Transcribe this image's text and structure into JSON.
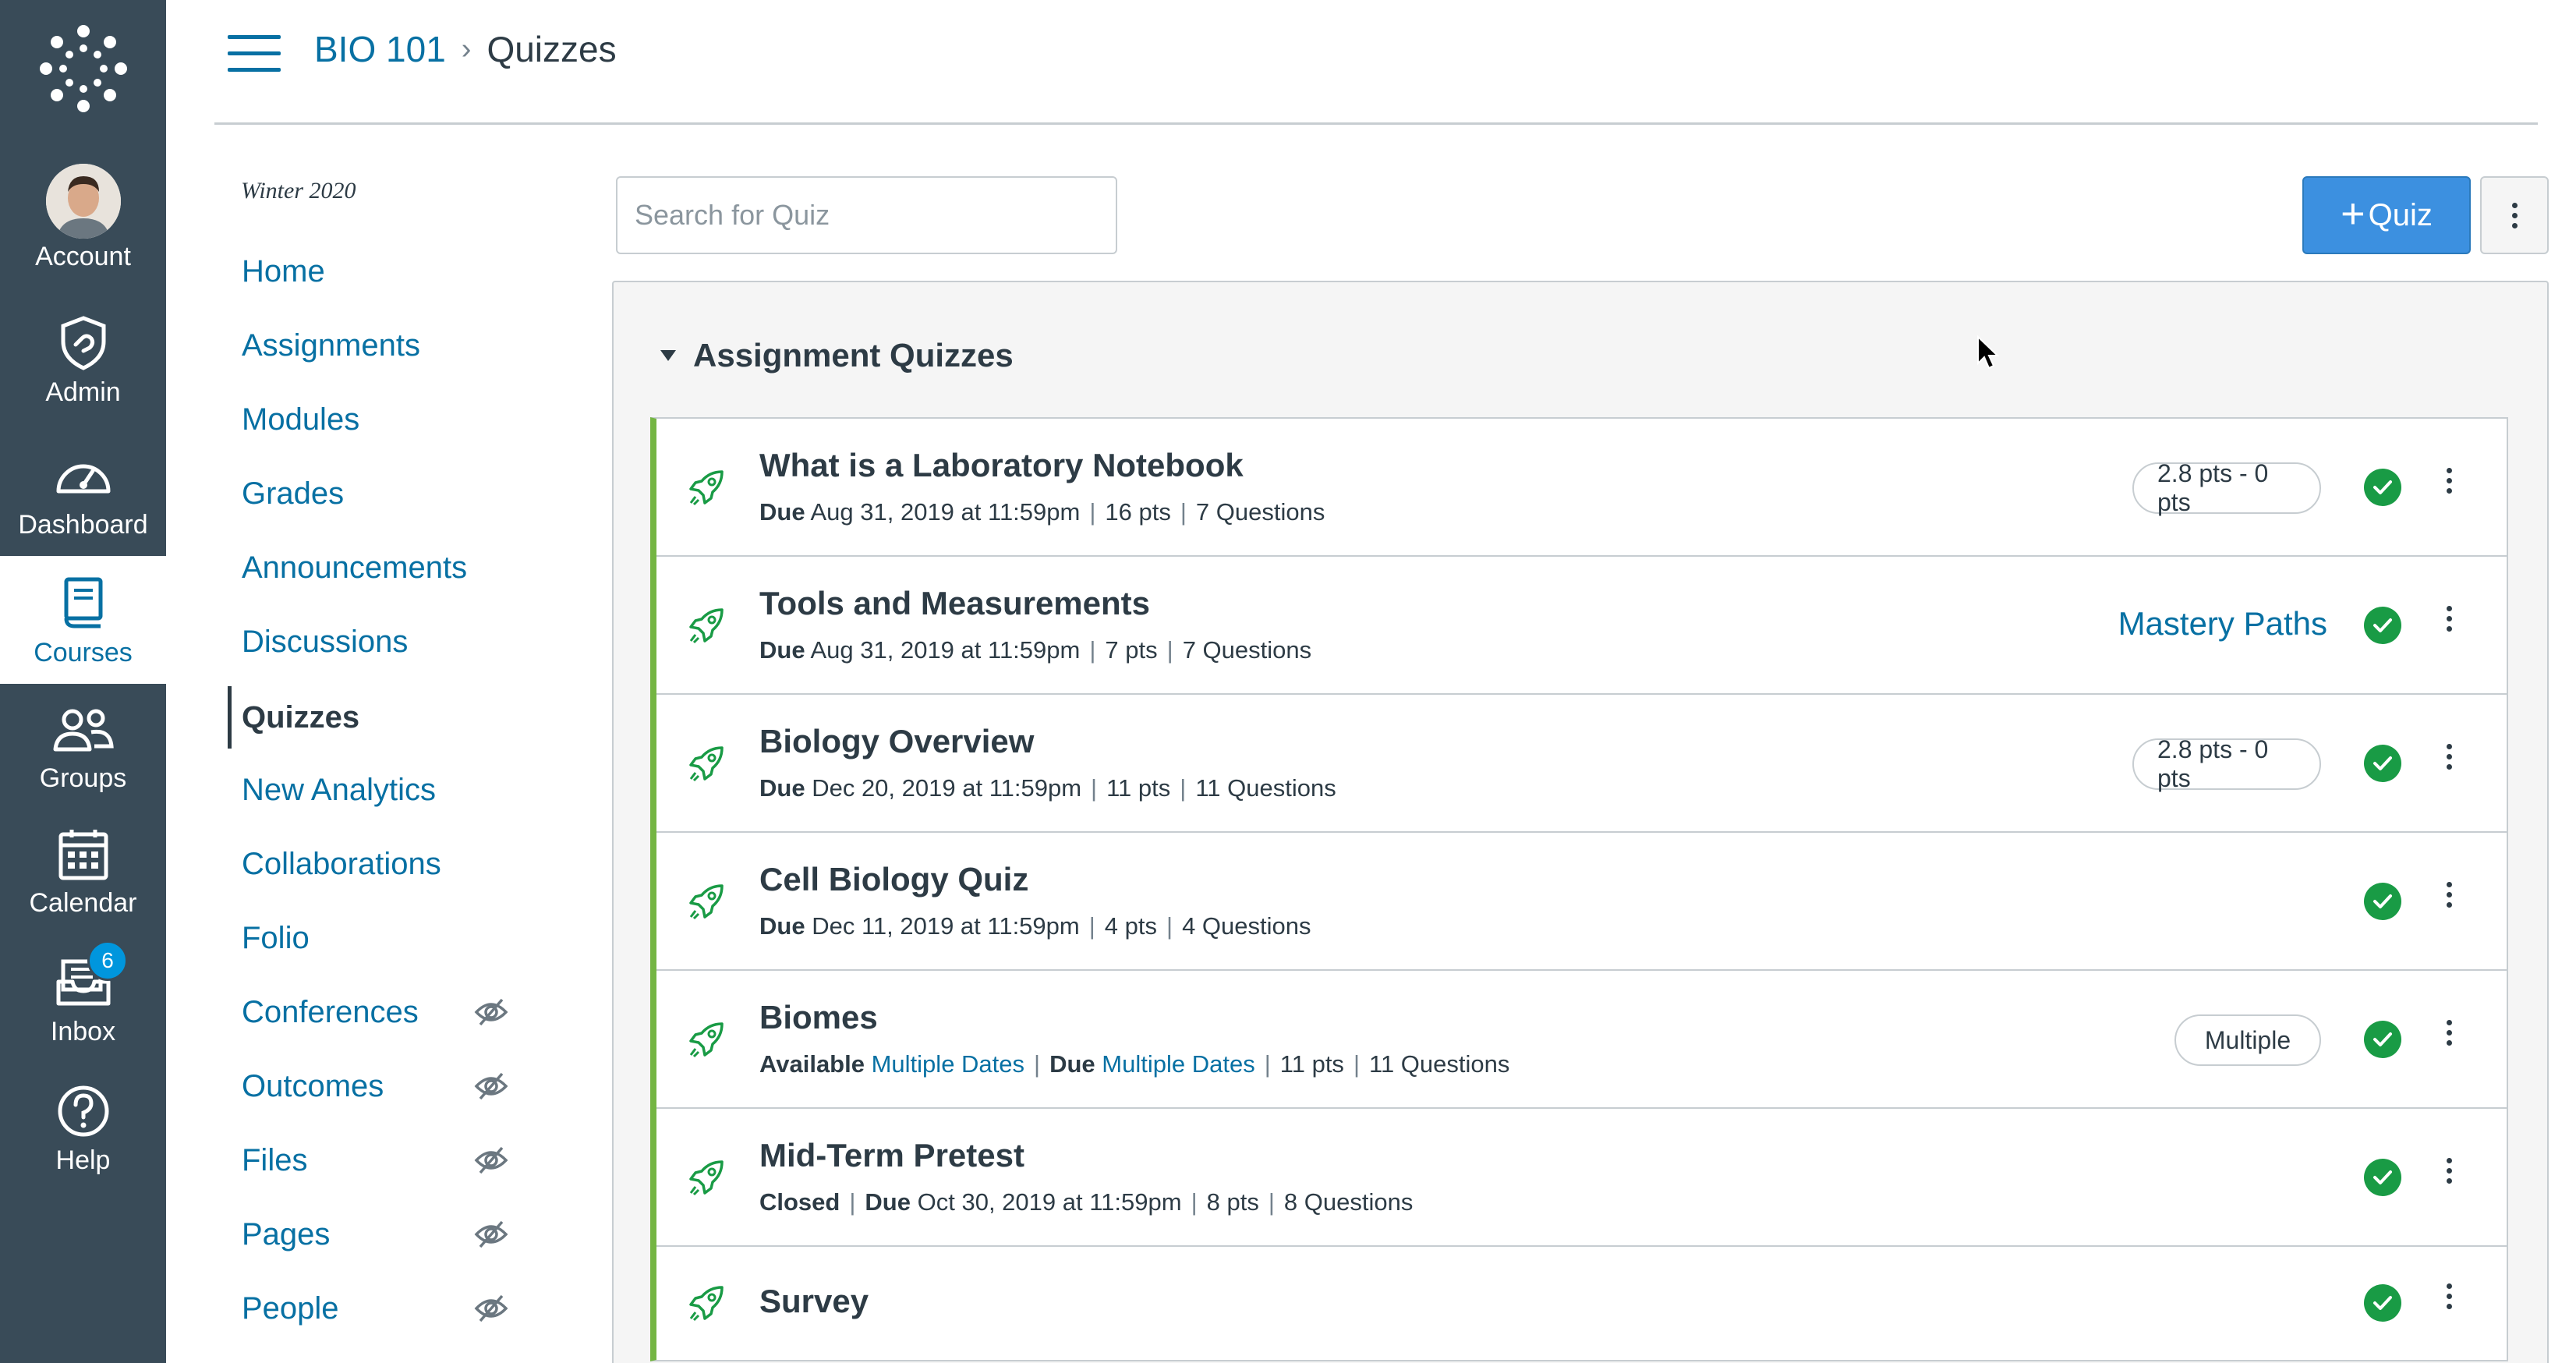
{
  "global_nav": {
    "items": [
      {
        "label": "Account",
        "icon": "avatar"
      },
      {
        "label": "Admin",
        "icon": "shield-icon"
      },
      {
        "label": "Dashboard",
        "icon": "speedometer-icon"
      },
      {
        "label": "Courses",
        "icon": "book-icon"
      },
      {
        "label": "Groups",
        "icon": "people-icon"
      },
      {
        "label": "Calendar",
        "icon": "calendar-icon"
      },
      {
        "label": "Inbox",
        "icon": "inbox-icon",
        "badge": "6"
      },
      {
        "label": "Help",
        "icon": "help-icon"
      }
    ],
    "active": "Courses",
    "colors": {
      "background": "#394b58",
      "active_text": "#0770a3"
    }
  },
  "header": {
    "course": "BIO 101",
    "separator": "›",
    "page": "Quizzes"
  },
  "course_nav": {
    "term": "Winter 2020",
    "items": [
      {
        "label": "Home"
      },
      {
        "label": "Assignments"
      },
      {
        "label": "Modules"
      },
      {
        "label": "Grades"
      },
      {
        "label": "Announcements"
      },
      {
        "label": "Discussions"
      },
      {
        "label": "Quizzes",
        "active": true
      },
      {
        "label": "New Analytics"
      },
      {
        "label": "Collaborations"
      },
      {
        "label": "Folio"
      },
      {
        "label": "Conferences",
        "hidden": true
      },
      {
        "label": "Outcomes",
        "hidden": true
      },
      {
        "label": "Files",
        "hidden": true
      },
      {
        "label": "Pages",
        "hidden": true
      },
      {
        "label": "People",
        "hidden": true
      }
    ]
  },
  "toolbar": {
    "search_placeholder": "Search for Quiz",
    "search_value": "",
    "add_quiz_plus": "+",
    "add_quiz_label": "Quiz"
  },
  "group": {
    "title": "Assignment Quizzes",
    "accent_color": "#74b543",
    "quizzes": [
      {
        "title": "What is a Laboratory Notebook",
        "due_label": "Due",
        "due": "Aug 31, 2019 at 11:59pm",
        "points": "16 pts",
        "questions": "7 Questions",
        "pill": "2.8 pts - 0 pts",
        "published": true
      },
      {
        "title": "Tools and Measurements",
        "due_label": "Due",
        "due": "Aug 31, 2019 at 11:59pm",
        "points": "7 pts",
        "questions": "7 Questions",
        "link": "Mastery Paths",
        "published": true
      },
      {
        "title": "Biology Overview",
        "due_label": "Due",
        "due": "Dec 20, 2019 at 11:59pm",
        "points": "11 pts",
        "questions": "11 Questions",
        "pill": "2.8 pts - 0 pts",
        "published": true
      },
      {
        "title": "Cell Biology Quiz",
        "due_label": "Due",
        "due": "Dec 11, 2019 at 11:59pm",
        "points": "4 pts",
        "questions": "4 Questions",
        "published": true
      },
      {
        "title": "Biomes",
        "available_label": "Available",
        "available": "Multiple Dates",
        "due_label": "Due",
        "due": "Multiple Dates",
        "points": "11 pts",
        "questions": "11 Questions",
        "pill": "Multiple",
        "published": true
      },
      {
        "title": "Mid-Term Pretest",
        "status": "Closed",
        "due_label": "Due",
        "due": "Oct 30, 2019 at 11:59pm",
        "points": "8 pts",
        "questions": "8 Questions",
        "published": true
      },
      {
        "title": "Survey",
        "published": true
      }
    ]
  },
  "meta_separator": "|"
}
